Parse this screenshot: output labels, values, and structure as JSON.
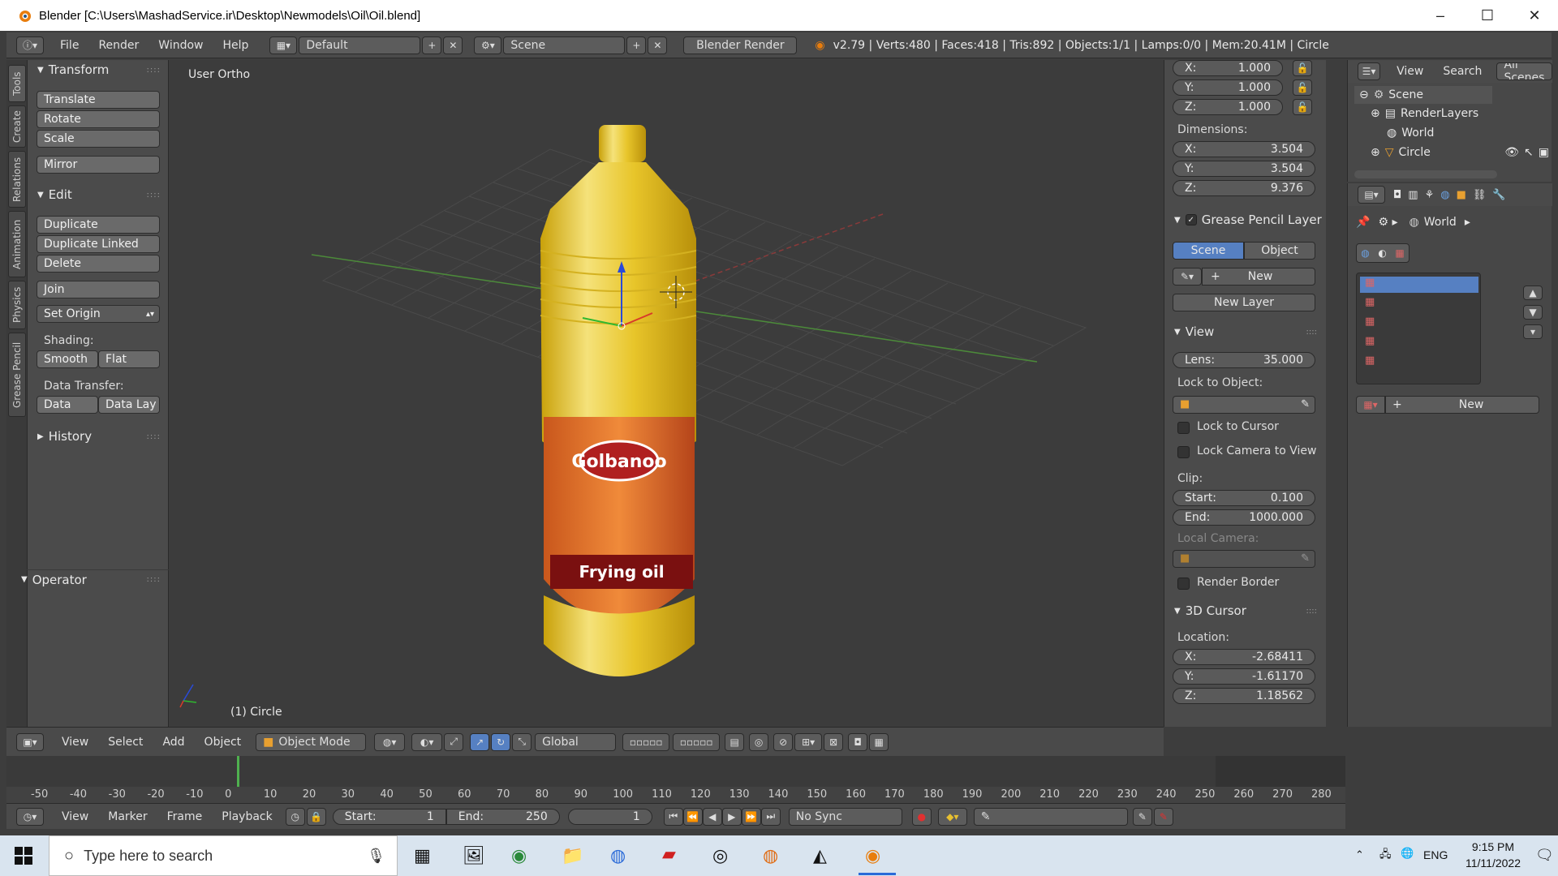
{
  "window": {
    "title": "Blender [C:\\Users\\MashadService.ir\\Desktop\\Newmodels\\Oil\\Oil.blend]",
    "minimize": "–",
    "maximize": "☐",
    "close": "✕"
  },
  "infobar": {
    "menus": [
      "File",
      "Render",
      "Window",
      "Help"
    ],
    "layout": "Default",
    "scene": "Scene",
    "engine": "Blender Render",
    "stats": "v2.79 | Verts:480 | Faces:418 | Tris:892 | Objects:1/1 | Lamps:0/0 | Mem:20.41M | Circle"
  },
  "tabs": [
    "Tools",
    "Create",
    "Relations",
    "Animation",
    "Physics",
    "Grease Pencil"
  ],
  "toolpanel": {
    "transform_header": "Transform",
    "translate": "Translate",
    "rotate": "Rotate",
    "scale": "Scale",
    "mirror": "Mirror",
    "edit_header": "Edit",
    "duplicate": "Duplicate",
    "duplicate_linked": "Duplicate Linked",
    "delete": "Delete",
    "join": "Join",
    "set_origin": "Set Origin",
    "shading_label": "Shading:",
    "smooth": "Smooth",
    "flat": "Flat",
    "data_transfer_label": "Data Transfer:",
    "data": "Data",
    "data_lay": "Data Lay",
    "history_header": "History",
    "operator_header": "Operator"
  },
  "viewport": {
    "view_name": "User Ortho",
    "object_label": "(1) Circle",
    "label_brand": "Golbanoo",
    "label_product": "Frying oil"
  },
  "viewheader": {
    "menus": [
      "View",
      "Select",
      "Add",
      "Object"
    ],
    "mode": "Object Mode",
    "orientation": "Global"
  },
  "npanel": {
    "scale_x": "1.000",
    "scale_y": "1.000",
    "scale_z": "1.000",
    "dimensions_label": "Dimensions:",
    "dim_x": "3.504",
    "dim_y": "3.504",
    "dim_z": "9.376",
    "grease_header": "Grease Pencil Layer",
    "scene_btn": "Scene",
    "object_btn": "Object",
    "new_btn": "New",
    "new_layer_btn": "New Layer",
    "view_header": "View",
    "lens_label": "Lens:",
    "lens": "35.000",
    "lock_object_label": "Lock to Object:",
    "lock_cursor": "Lock to Cursor",
    "lock_camera": "Lock Camera to View",
    "clip_label": "Clip:",
    "clip_start_label": "Start:",
    "clip_start": "0.100",
    "clip_end_label": "End:",
    "clip_end": "1000.000",
    "local_camera_label": "Local Camera:",
    "render_border": "Render Border",
    "cursor_header": "3D Cursor",
    "location_label": "Location:",
    "cur_x": "-2.68411",
    "cur_y": "-1.61170",
    "cur_z": "1.18562",
    "axis_x": "X:",
    "axis_y": "Y:",
    "axis_z": "Z:"
  },
  "outliner": {
    "view": "View",
    "search": "Search",
    "filter": "All Scenes",
    "items": [
      "Scene",
      "RenderLayers",
      "World",
      "Circle"
    ]
  },
  "propeditor": {
    "context": "World",
    "new_btn": "New"
  },
  "timeline": {
    "ticks": [
      "-50",
      "-40",
      "-30",
      "-20",
      "-10",
      "0",
      "10",
      "20",
      "30",
      "40",
      "50",
      "60",
      "70",
      "80",
      "90",
      "100",
      "110",
      "120",
      "130",
      "140",
      "150",
      "160",
      "170",
      "180",
      "190",
      "200",
      "210",
      "220",
      "230",
      "240",
      "250",
      "260",
      "270",
      "280"
    ],
    "menus": [
      "View",
      "Marker",
      "Frame",
      "Playback"
    ],
    "start_label": "Start:",
    "start": "1",
    "end_label": "End:",
    "end": "250",
    "current": "1",
    "sync": "No Sync"
  },
  "taskbar": {
    "search_placeholder": "Type here to search",
    "lang": "ENG",
    "time": "9:15 PM",
    "date": "11/11/2022"
  }
}
